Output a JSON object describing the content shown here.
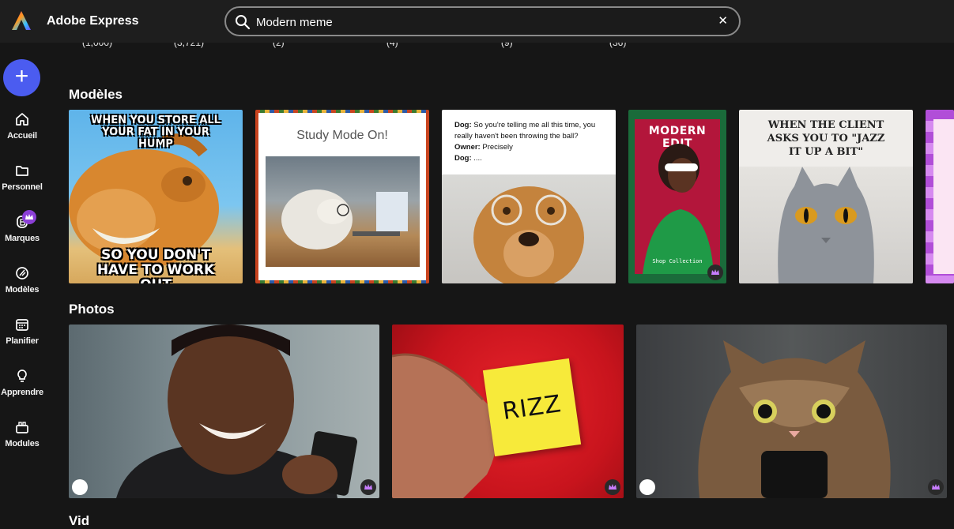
{
  "app": {
    "title": "Adobe Express"
  },
  "search": {
    "value": "Modern meme"
  },
  "counts": [
    "(1,000)",
    "(3,721)",
    "(2)",
    "(4)",
    "(9)",
    "(36)"
  ],
  "sidebar": {
    "create_label": "+",
    "items": [
      {
        "label": "Accueil",
        "icon": "home-icon"
      },
      {
        "label": "Personnel",
        "icon": "folder-icon"
      },
      {
        "label": "Marques",
        "icon": "brand-icon"
      },
      {
        "label": "Modèles",
        "icon": "templates-icon"
      },
      {
        "label": "Planifier",
        "icon": "calendar-icon"
      },
      {
        "label": "Apprendre",
        "icon": "lightbulb-icon"
      },
      {
        "label": "Modules",
        "icon": "addons-icon"
      }
    ]
  },
  "sections": {
    "templates": "Modèles",
    "photos": "Photos",
    "videos": "Vid"
  },
  "templates": [
    {
      "top": "WHEN YOU STORE ALL YOUR FAT IN YOUR HUMP",
      "bottom": "SO YOU DON'T HAVE TO WORK OUT"
    },
    {
      "title": "Study Mode On!"
    },
    {
      "dialog": [
        {
          "speaker": "Dog:",
          "line": "So you're telling me all this time, you really haven't been throwing the ball?"
        },
        {
          "speaker": "Owner:",
          "line": "Precisely"
        },
        {
          "speaker": "Dog:",
          "line": "...."
        }
      ]
    },
    {
      "title": "MODERN EDIT",
      "footer": "Shop Collection"
    },
    {
      "title": "WHEN THE CLIENT ASKS YOU TO \"JAZZ IT UP A BIT\""
    }
  ],
  "photos": [
    {
      "alt": "laughing man with phone"
    },
    {
      "note": "RIZZ"
    },
    {
      "alt": "cat with phone"
    }
  ],
  "colors": {
    "accent": "#4b5cf0",
    "premium": "#8b3fd6",
    "topbar": "#1e1e1e",
    "background": "#161616"
  }
}
